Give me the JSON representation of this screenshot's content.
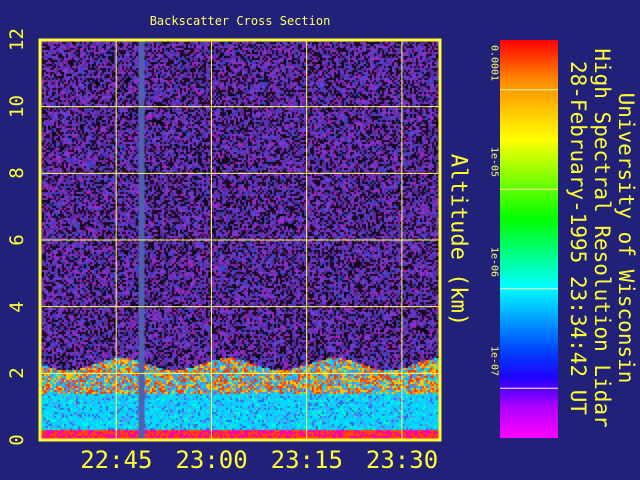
{
  "chart_data": {
    "type": "heatmap",
    "title": "Backscatter Cross Section",
    "xlabel": "",
    "ylabel": "Altitude (km)",
    "xlim": [
      "22:33",
      "23:36"
    ],
    "ylim": [
      0,
      12
    ],
    "x_ticks": [
      "22:45",
      "23:00",
      "23:15",
      "23:30"
    ],
    "y_ticks": [
      "0",
      "2",
      "4",
      "6",
      "8",
      "10",
      "12"
    ],
    "grid": true,
    "data_gap": {
      "time": "22:49",
      "description": "vertical band of missing data"
    },
    "boundary_layer": {
      "approx_top_km": 2.0
    },
    "colorbar": {
      "scale": "log",
      "ticks": [
        "0.0001",
        "1e-05",
        "1e-06",
        "1e-07"
      ],
      "colors": [
        "#ff0000",
        "#ff8800",
        "#ffff00",
        "#00ff00",
        "#00ffff",
        "#0055ff",
        "#aa00ff",
        "#ff00ff"
      ]
    },
    "info_lines": [
      "University of Wisconsin",
      "High Spectral Resolution Lidar",
      "28-February-1995 23:34:42 UT"
    ]
  }
}
